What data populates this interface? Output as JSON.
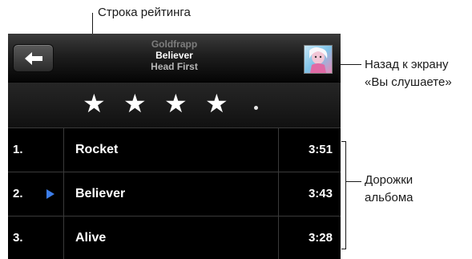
{
  "callouts": {
    "rating_bar": "Строка рейтинга",
    "back_to_now_playing_line1": "Назад к экрану",
    "back_to_now_playing_line2": "«Вы слушаете»",
    "album_tracks_line1": "Дорожки",
    "album_tracks_line2": "альбома"
  },
  "now_playing": {
    "artist": "Goldfrapp",
    "song": "Believer",
    "album": "Head First"
  },
  "rating": {
    "stars": 4,
    "max": 5
  },
  "tracks": [
    {
      "number": "1.",
      "title": "Rocket",
      "duration": "3:51",
      "playing": false
    },
    {
      "number": "2.",
      "title": "Believer",
      "duration": "3:43",
      "playing": true
    },
    {
      "number": "3.",
      "title": "Alive",
      "duration": "3:28",
      "playing": false
    }
  ],
  "colors": {
    "play_indicator": "#3c7de8",
    "screen_background": "#000000"
  },
  "icons": {
    "back": "back-arrow-icon",
    "album_art": "album-art-thumbnail",
    "star": "star-icon"
  }
}
